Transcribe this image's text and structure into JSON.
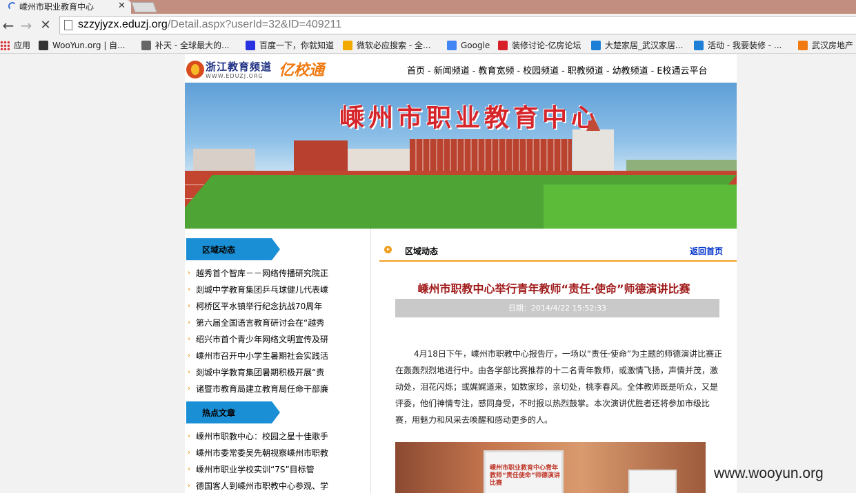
{
  "browser": {
    "tab_title": "嵊州市职业教育中心",
    "url_host": "szzyjyzx.eduzj.org",
    "url_path": "/Detail.aspx?userId=32&ID=409211",
    "bookmarks": [
      {
        "label": "应用",
        "icon": "apps-grid-icon",
        "color": "#d33b2c"
      },
      {
        "label": "WooYun.org | 自...",
        "icon": "wooyun-icon",
        "color": "#333333"
      },
      {
        "label": "补天 - 全球最大的...",
        "icon": "butian-icon",
        "color": "#666666"
      },
      {
        "label": "百度一下，你就知道",
        "icon": "baidu-icon",
        "color": "#2932e1"
      },
      {
        "label": "微软必应搜索 - 全...",
        "icon": "bing-icon",
        "color": "#f2a900"
      },
      {
        "label": "Google",
        "icon": "google-icon",
        "color": "#4285f4"
      },
      {
        "label": "装修讨论-亿房论坛",
        "icon": "fang-icon",
        "color": "#d61f26"
      },
      {
        "label": "大楚家居_武汉家居...",
        "icon": "ie-icon",
        "color": "#1d7fd6"
      },
      {
        "label": "活动 - 我要装修 - ...",
        "icon": "ie-icon",
        "color": "#1d7fd6"
      },
      {
        "label": "武汉房地产",
        "icon": "house-icon",
        "color": "#f07a11"
      }
    ]
  },
  "site": {
    "logo_title": "浙江教育频道",
    "logo_domain": "WWW.EDUZJ.ORG",
    "brand": "亿校通",
    "nav": [
      "首页",
      "新闻频道",
      "教育宽频",
      "校园频道",
      "职教频道",
      "幼教频道",
      "E校通云平台"
    ],
    "nav_separator": "-",
    "banner_title": "嵊州市职业教育中心"
  },
  "left": {
    "section1_title": "区域动态",
    "section1_items": [
      "越秀首个智库－－网络传播研究院正",
      "剡城中学教育集团乒乓球健儿代表嵊",
      "柯桥区平水镇举行纪念抗战70周年",
      "第六届全国语言教育研讨会在“越秀",
      "绍兴市首个青少年网络文明宣传及研",
      "嵊州市召开中小学生暑期社会实践活",
      "剡城中学教育集团暑期积极开展“责",
      "诸暨市教育局建立教育局任命干部廉"
    ],
    "section2_title": "热点文章",
    "section2_items": [
      "嵊州市职教中心：校园之星十佳歌手",
      "嵊州市委常委吴先朝视察嵊州市职教",
      "嵊州市职业学校实训“7S”目标管",
      "德国客人到嵊州市职教中心参观、学"
    ]
  },
  "article": {
    "section_label": "区域动态",
    "back_link": "返回首页",
    "title": "嵊州市职教中心举行青年教师“责任·使命”师德演讲比赛",
    "date_label": "日期：",
    "date_value": "2014/4/22 15:52:33",
    "body": "4月18日下午，嵊州市职教中心报告厅，一场以“责任·使命”为主题的师德演讲比赛正在轰轰烈烈地进行中。由各学部比赛推荐的十二名青年教师，或激情飞扬，声情并茂，激动处，泪花闪烁；或娓娓道来，如数家珍，亲切处，桃李春风。全体教师既是听众，又是评委，他们神情专注，感同身受，不时报以热烈鼓掌。本次演讲优胜者还将参加市级比赛，用魅力和风采去唤醒和感动更多的人。",
    "photo_screen_text": "嵊州市职业教育中心青年教师“责任使命”师德演讲比赛"
  },
  "watermark": "www.wooyun.org",
  "colors": {
    "tab_strip": "#c28e7f",
    "accent_orange": "#f0a020",
    "section_tab_blue": "#1a8fd5",
    "article_title_red": "#a01a1a",
    "link_blue": "#0033cc"
  }
}
